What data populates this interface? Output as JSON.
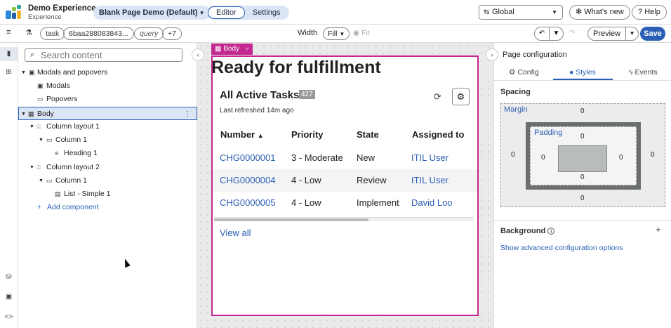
{
  "app": {
    "title": "Demo Experience",
    "subtitle": "Experience",
    "page_selector": "Blank Page Demo (Default)",
    "mode_tabs": [
      "Editor",
      "Settings"
    ],
    "active_mode": "Editor",
    "scope_selector": "Global",
    "whats_new": "What's new",
    "help": "Help"
  },
  "toolbar": {
    "chips": [
      "task",
      "6baa288083843...",
      "query",
      "+7"
    ],
    "width_label": "Width",
    "width_value": "Fill",
    "fit_label": "Fit",
    "preview_label": "Preview",
    "save_label": "Save"
  },
  "tree": {
    "search_placeholder": "Search content",
    "items": [
      {
        "label": "Modals and popovers"
      },
      {
        "label": "Modals"
      },
      {
        "label": "Popovers"
      },
      {
        "label": "Body"
      },
      {
        "label": "Column layout 1"
      },
      {
        "label": "Column 1"
      },
      {
        "label": "Heading 1"
      },
      {
        "label": "Column layout 2"
      },
      {
        "label": "Column 1"
      },
      {
        "label": "List - Simple 1"
      }
    ],
    "add_component": "Add component"
  },
  "canvas": {
    "body_tag": "Body",
    "heading": "Ready for fulfillment",
    "list_title": "All Active Tasks",
    "list_count": "427",
    "last_refreshed": "Last refreshed 14m ago",
    "columns": [
      "Number",
      "Priority",
      "State",
      "Assigned to"
    ],
    "sort_indicator": "▲",
    "rows": [
      {
        "number": "CHG0000001",
        "priority": "3 - Moderate",
        "state": "New",
        "assigned": "ITIL User"
      },
      {
        "number": "CHG0000004",
        "priority": "4 - Low",
        "state": "Review",
        "assigned": "ITIL User"
      },
      {
        "number": "CHG0000005",
        "priority": "4 - Low",
        "state": "Implement",
        "assigned": "David Loo"
      }
    ],
    "view_all": "View all"
  },
  "config": {
    "title": "Page configuration",
    "tabs": [
      "Config",
      "Styles",
      "Events"
    ],
    "active_tab": "Styles",
    "spacing_label": "Spacing",
    "margin_label": "Margin",
    "padding_label": "Padding",
    "margin": {
      "top": "0",
      "right": "0",
      "bottom": "0",
      "left": "0"
    },
    "padding": {
      "top": "0",
      "right": "0",
      "bottom": "0",
      "left": "0"
    },
    "background_label": "Background",
    "advanced_link": "Show advanced configuration options"
  },
  "colors": {
    "accent": "#2b5fb5",
    "selection_magenta": "#c2288f",
    "selected_row_bg": "#dbe5f5"
  }
}
